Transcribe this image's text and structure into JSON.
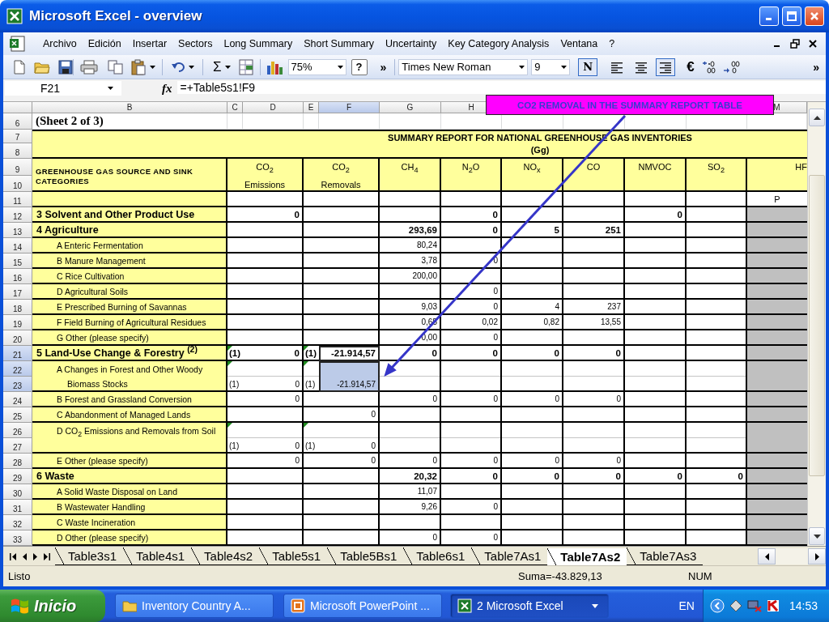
{
  "window": {
    "title": "Microsoft Excel - overview"
  },
  "menu": [
    "Archivo",
    "Edición",
    "Insertar",
    "Sectors",
    "Long Summary",
    "Short Summary",
    "Uncertainty",
    "Key Category Analysis",
    "Ventana",
    "?"
  ],
  "standard_toolbar": {
    "sum_symbol": "Σ",
    "zoom": "75%",
    "help_symbol": "?",
    "overflow": "»"
  },
  "format_toolbar": {
    "font": "Times New Roman",
    "size": "9",
    "bold": {
      "label": "N",
      "pressed": true
    },
    "alignment": [
      {
        "kind": "left",
        "pressed": false
      },
      {
        "kind": "center",
        "pressed": false
      },
      {
        "kind": "right",
        "pressed": true
      }
    ],
    "currency": "€",
    "overflow": "»"
  },
  "formula_bar": {
    "name_box": "F21",
    "function_label": "fx",
    "formula": "=+Table5s1!F9"
  },
  "callout": {
    "text": "CO2 REMOVAL IN THE SUMMARY REPORT TABLE"
  },
  "sheet": {
    "column_headers": {
      "left": [
        "B",
        "C",
        "D",
        "E",
        "F",
        "G",
        "H"
      ],
      "right": [
        "M"
      ]
    },
    "sheet_note": {
      "rows": [
        "6"
      ],
      "text": "(Sheet 2 of 3)"
    },
    "title": {
      "rows": [
        "7",
        "8"
      ],
      "lines": [
        "SUMMARY REPORT FOR NATIONAL GREENHOUSE GAS INVENTORIES",
        "(Gg)"
      ]
    },
    "header": {
      "rows": [
        "9",
        "10"
      ],
      "category": "GREENHOUSE GAS SOURCE AND SINK CATEGORIES",
      "gases": [
        {
          "label": "CO$_{2}$",
          "second_line": "Emissions",
          "shaded": false
        },
        {
          "label": "CO$_{2}$",
          "second_line": "Removals",
          "shaded": false
        },
        {
          "label": "CH$_{4}$",
          "shaded": false
        },
        {
          "label": "N$_{2}$O",
          "shaded": false
        },
        {
          "label": "NO$_{x}$",
          "shaded": false
        },
        {
          "label": "CO",
          "shaded": false
        },
        {
          "label": "NMVOC",
          "shaded": false
        },
        {
          "label": "SO$_{2}$",
          "shaded": false
        },
        {
          "label": "HF",
          "shaded": true
        }
      ]
    },
    "unit_row": {
      "rows": [
        "11"
      ],
      "hfc": "P"
    },
    "sections": [
      {
        "rows": [
          "12"
        ],
        "label": "3 Solvent and Other Product Use",
        "values": {
          "co2_emissions": {
            "value": "0"
          },
          "n2o": "0",
          "nmvoc": "0"
        }
      },
      {
        "rows": [
          "13"
        ],
        "label": "4 Agriculture",
        "values": {
          "ch4": "293,69",
          "n2o": "0",
          "nox": "5",
          "co": "251"
        },
        "children": [
          {
            "rows": [
              "14"
            ],
            "label": "A Enteric Fermentation",
            "values": {
              "ch4": "80,24"
            }
          },
          {
            "rows": [
              "15"
            ],
            "label": "B Manure Management",
            "values": {
              "ch4": "3,78",
              "n2o": "0"
            }
          },
          {
            "rows": [
              "16"
            ],
            "label": "C Rice Cultivation",
            "values": {
              "ch4": "200,00"
            }
          },
          {
            "rows": [
              "17"
            ],
            "label": "D Agricultural Soils",
            "values": {
              "n2o": "0"
            }
          },
          {
            "rows": [
              "18"
            ],
            "label": "E Prescribed Burning of Savannas",
            "values": {
              "ch4": "9,03",
              "n2o": "0",
              "nox": "4",
              "co": "237"
            }
          },
          {
            "rows": [
              "19"
            ],
            "label": "F Field Burning of Agricultural Residues",
            "values": {
              "ch4": "0,65",
              "n2o": "0,02",
              "nox": "0,82",
              "co": "13,55"
            }
          },
          {
            "rows": [
              "20"
            ],
            "label": "G Other (please specify)",
            "values": {
              "ch4": "0,00",
              "n2o": "0"
            }
          }
        ]
      },
      {
        "rows": [
          "21"
        ],
        "label": "5 Land-Use Change & Forestry $^{(2)}$",
        "values": {
          "co2_emissions": {
            "footnote": {
              "text": "(1)",
              "flagged": true
            },
            "value": "0"
          },
          "co2_removals": {
            "footnote": {
              "text": "(1)",
              "flagged": true
            },
            "value": "-21.914,57",
            "selected": true
          },
          "ch4": "0",
          "n2o": "0",
          "nox": "0",
          "co": "0"
        },
        "children": [
          {
            "rows": [
              "22",
              "23"
            ],
            "label": "A Changes in Forest and Other Woody Biomass Stocks",
            "values": {
              "co2_emissions": {
                "footnote": {
                  "text": "(1)",
                  "flagged": true
                },
                "value": "0"
              },
              "co2_removals": {
                "footnote": {
                  "text": "(1)",
                  "flagged": true
                },
                "value": "-21.914,57",
                "selected": true
              }
            }
          },
          {
            "rows": [
              "24"
            ],
            "label": "B Forest and Grassland Conversion",
            "values": {
              "co2_emissions": {
                "value": "0"
              },
              "ch4": "0",
              "n2o": "0",
              "nox": "0",
              "co": "0"
            }
          },
          {
            "rows": [
              "25"
            ],
            "label": "C Abandonment of Managed Lands",
            "values": {
              "co2_removals": {
                "value": "0",
                "selected": false
              }
            }
          },
          {
            "rows": [
              "26",
              "27"
            ],
            "label": "D CO$_{2}$ Emissions and Removals from Soil",
            "values": {
              "co2_emissions": {
                "footnote": {
                  "text": "(1)",
                  "flagged": true
                },
                "value": "0"
              },
              "co2_removals": {
                "footnote": {
                  "text": "(1)",
                  "flagged": true
                },
                "value": "0",
                "selected": false
              }
            }
          },
          {
            "rows": [
              "28"
            ],
            "label": "E Other (please specify)",
            "values": {
              "co2_emissions": {
                "value": "0"
              },
              "co2_removals": {
                "value": "0",
                "selected": false
              },
              "ch4": "0",
              "n2o": "0",
              "nox": "0",
              "co": "0"
            }
          }
        ]
      },
      {
        "rows": [
          "29"
        ],
        "label": "6 Waste",
        "values": {
          "ch4": "20,32",
          "n2o": "0",
          "nox": "0",
          "co": "0",
          "nmvoc": "0",
          "so2": "0"
        },
        "children": [
          {
            "rows": [
              "30"
            ],
            "label": "A Solid Waste Disposal on Land",
            "values": {
              "ch4": "11,07"
            }
          },
          {
            "rows": [
              "31"
            ],
            "label": "B Wastewater Handling",
            "values": {
              "ch4": "9,26",
              "n2o": "0"
            }
          },
          {
            "rows": [
              "32"
            ],
            "label": "C Waste Incineration"
          },
          {
            "rows": [
              "33"
            ],
            "label": "D Other (please specify)",
            "values": {
              "ch4": "0",
              "n2o": "0"
            }
          }
        ]
      }
    ]
  },
  "sheet_tabs": [
    {
      "label": "Table3s1",
      "selected": false
    },
    {
      "label": "Table4s1",
      "selected": false
    },
    {
      "label": "Table4s2",
      "selected": false
    },
    {
      "label": "Table5s1",
      "selected": false
    },
    {
      "label": "Table5Bs1",
      "selected": false
    },
    {
      "label": "Table6s1",
      "selected": false
    },
    {
      "label": "Table7As1",
      "selected": false
    },
    {
      "label": "Table7As2",
      "selected": true
    },
    {
      "label": "Table7As3",
      "selected": false
    }
  ],
  "status_bar": {
    "message": "Listo",
    "sum": "Suma=-43.829,13",
    "mode": "NUM"
  },
  "taskbar": {
    "start": "Inicio",
    "tasks": [
      {
        "label": "Inventory Country A...",
        "kind": "folder",
        "selected": false,
        "grouped": false
      },
      {
        "label": "Microsoft PowerPoint ...",
        "kind": "presentation",
        "selected": false,
        "grouped": false
      },
      {
        "label": "2 Microsoft Excel",
        "kind": "spreadsheet",
        "selected": true,
        "grouped": true
      }
    ],
    "language": "EN",
    "clock": "14:53"
  }
}
